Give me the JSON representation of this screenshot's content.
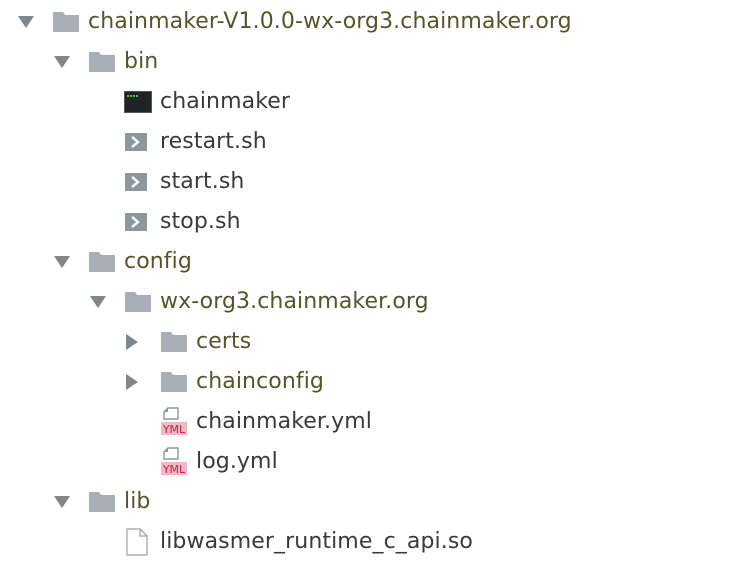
{
  "tree": {
    "root": {
      "label": "chainmaker-V1.0.0-wx-org3.chainmaker.org",
      "icon": "folder-icon",
      "state": "expanded"
    },
    "bin": {
      "label": "bin",
      "icon": "folder-icon",
      "state": "expanded",
      "children": [
        {
          "label": "chainmaker",
          "icon": "terminal-binary-icon"
        },
        {
          "label": "restart.sh",
          "icon": "shell-script-icon"
        },
        {
          "label": "start.sh",
          "icon": "shell-script-icon"
        },
        {
          "label": "stop.sh",
          "icon": "shell-script-icon"
        }
      ]
    },
    "config": {
      "label": "config",
      "icon": "folder-icon",
      "state": "expanded",
      "org": {
        "label": "wx-org3.chainmaker.org",
        "icon": "folder-icon",
        "state": "expanded",
        "children": [
          {
            "label": "certs",
            "icon": "folder-icon",
            "state": "collapsed"
          },
          {
            "label": "chainconfig",
            "icon": "folder-icon",
            "state": "collapsed"
          },
          {
            "label": "chainmaker.yml",
            "icon": "yml-file-icon",
            "badge": "YML"
          },
          {
            "label": "log.yml",
            "icon": "yml-file-icon",
            "badge": "YML"
          }
        ]
      }
    },
    "lib": {
      "label": "lib",
      "icon": "folder-icon",
      "state": "expanded",
      "children": [
        {
          "label": "libwasmer_runtime_c_api.so",
          "icon": "generic-file-icon"
        }
      ]
    }
  },
  "colors": {
    "folder": "#a7aeb5",
    "arrow": "#7f868c",
    "label": "#55552a",
    "yml_badge_bg": "#f2b8c6",
    "yml_badge_text": "#c0213f"
  }
}
